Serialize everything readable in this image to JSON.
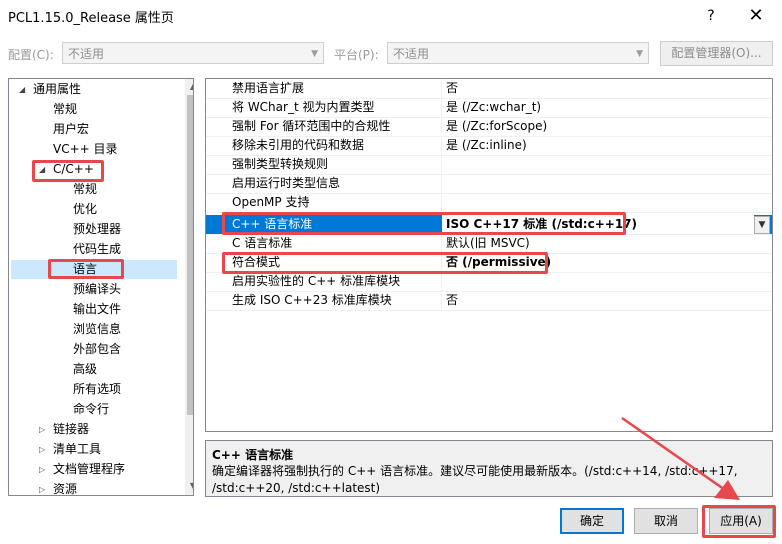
{
  "window": {
    "title": "PCL1.15.0_Release 属性页",
    "help": "?",
    "close": "✕"
  },
  "config": {
    "config_label": "配置(C):",
    "config_value": "不适用",
    "platform_label": "平台(P):",
    "platform_value": "不适用",
    "manager_button": "配置管理器(O)..."
  },
  "tree": {
    "root": "通用属性",
    "items": [
      "常规",
      "用户宏",
      "VC++ 目录"
    ],
    "cpp": "C/C++",
    "cpp_children": [
      "常规",
      "优化",
      "预处理器",
      "代码生成",
      "语言",
      "预编译头",
      "输出文件",
      "浏览信息",
      "外部包含",
      "高级",
      "所有选项",
      "命令行"
    ],
    "after": [
      "链接器",
      "清单工具",
      "文档管理程序",
      "资源"
    ]
  },
  "grid": {
    "rows": [
      {
        "name": "禁用语言扩展",
        "value": "否"
      },
      {
        "name": "将 WChar_t 视为内置类型",
        "value": "是 (/Zc:wchar_t)"
      },
      {
        "name": "强制 For 循环范围中的合规性",
        "value": "是 (/Zc:forScope)"
      },
      {
        "name": "移除未引用的代码和数据",
        "value": "是 (/Zc:inline)"
      },
      {
        "name": "强制类型转换规则",
        "value": ""
      },
      {
        "name": "启用运行时类型信息",
        "value": ""
      },
      {
        "name": "OpenMP 支持",
        "value": ""
      },
      {
        "name": "C++ 语言标准",
        "value": "ISO C++17 标准 (/std:c++17)"
      },
      {
        "name": "C 语言标准",
        "value": "默认(旧 MSVC)"
      },
      {
        "name": "符合模式",
        "value": "否 (/permissive)"
      },
      {
        "name": "启用实验性的 C++ 标准库模块",
        "value": ""
      },
      {
        "name": "生成 ISO C++23 标准库模块",
        "value": "否"
      }
    ]
  },
  "description": {
    "title": "C++ 语言标准",
    "text": "确定编译器将强制执行的 C++ 语言标准。建议尽可能使用最新版本。(/std:c++14, /std:c++17, /std:c++20, /std:c++latest)"
  },
  "buttons": {
    "ok": "确定",
    "cancel": "取消",
    "apply": "应用(A)"
  },
  "colors": {
    "highlight": "#e8474c",
    "selection": "#0078d7"
  }
}
